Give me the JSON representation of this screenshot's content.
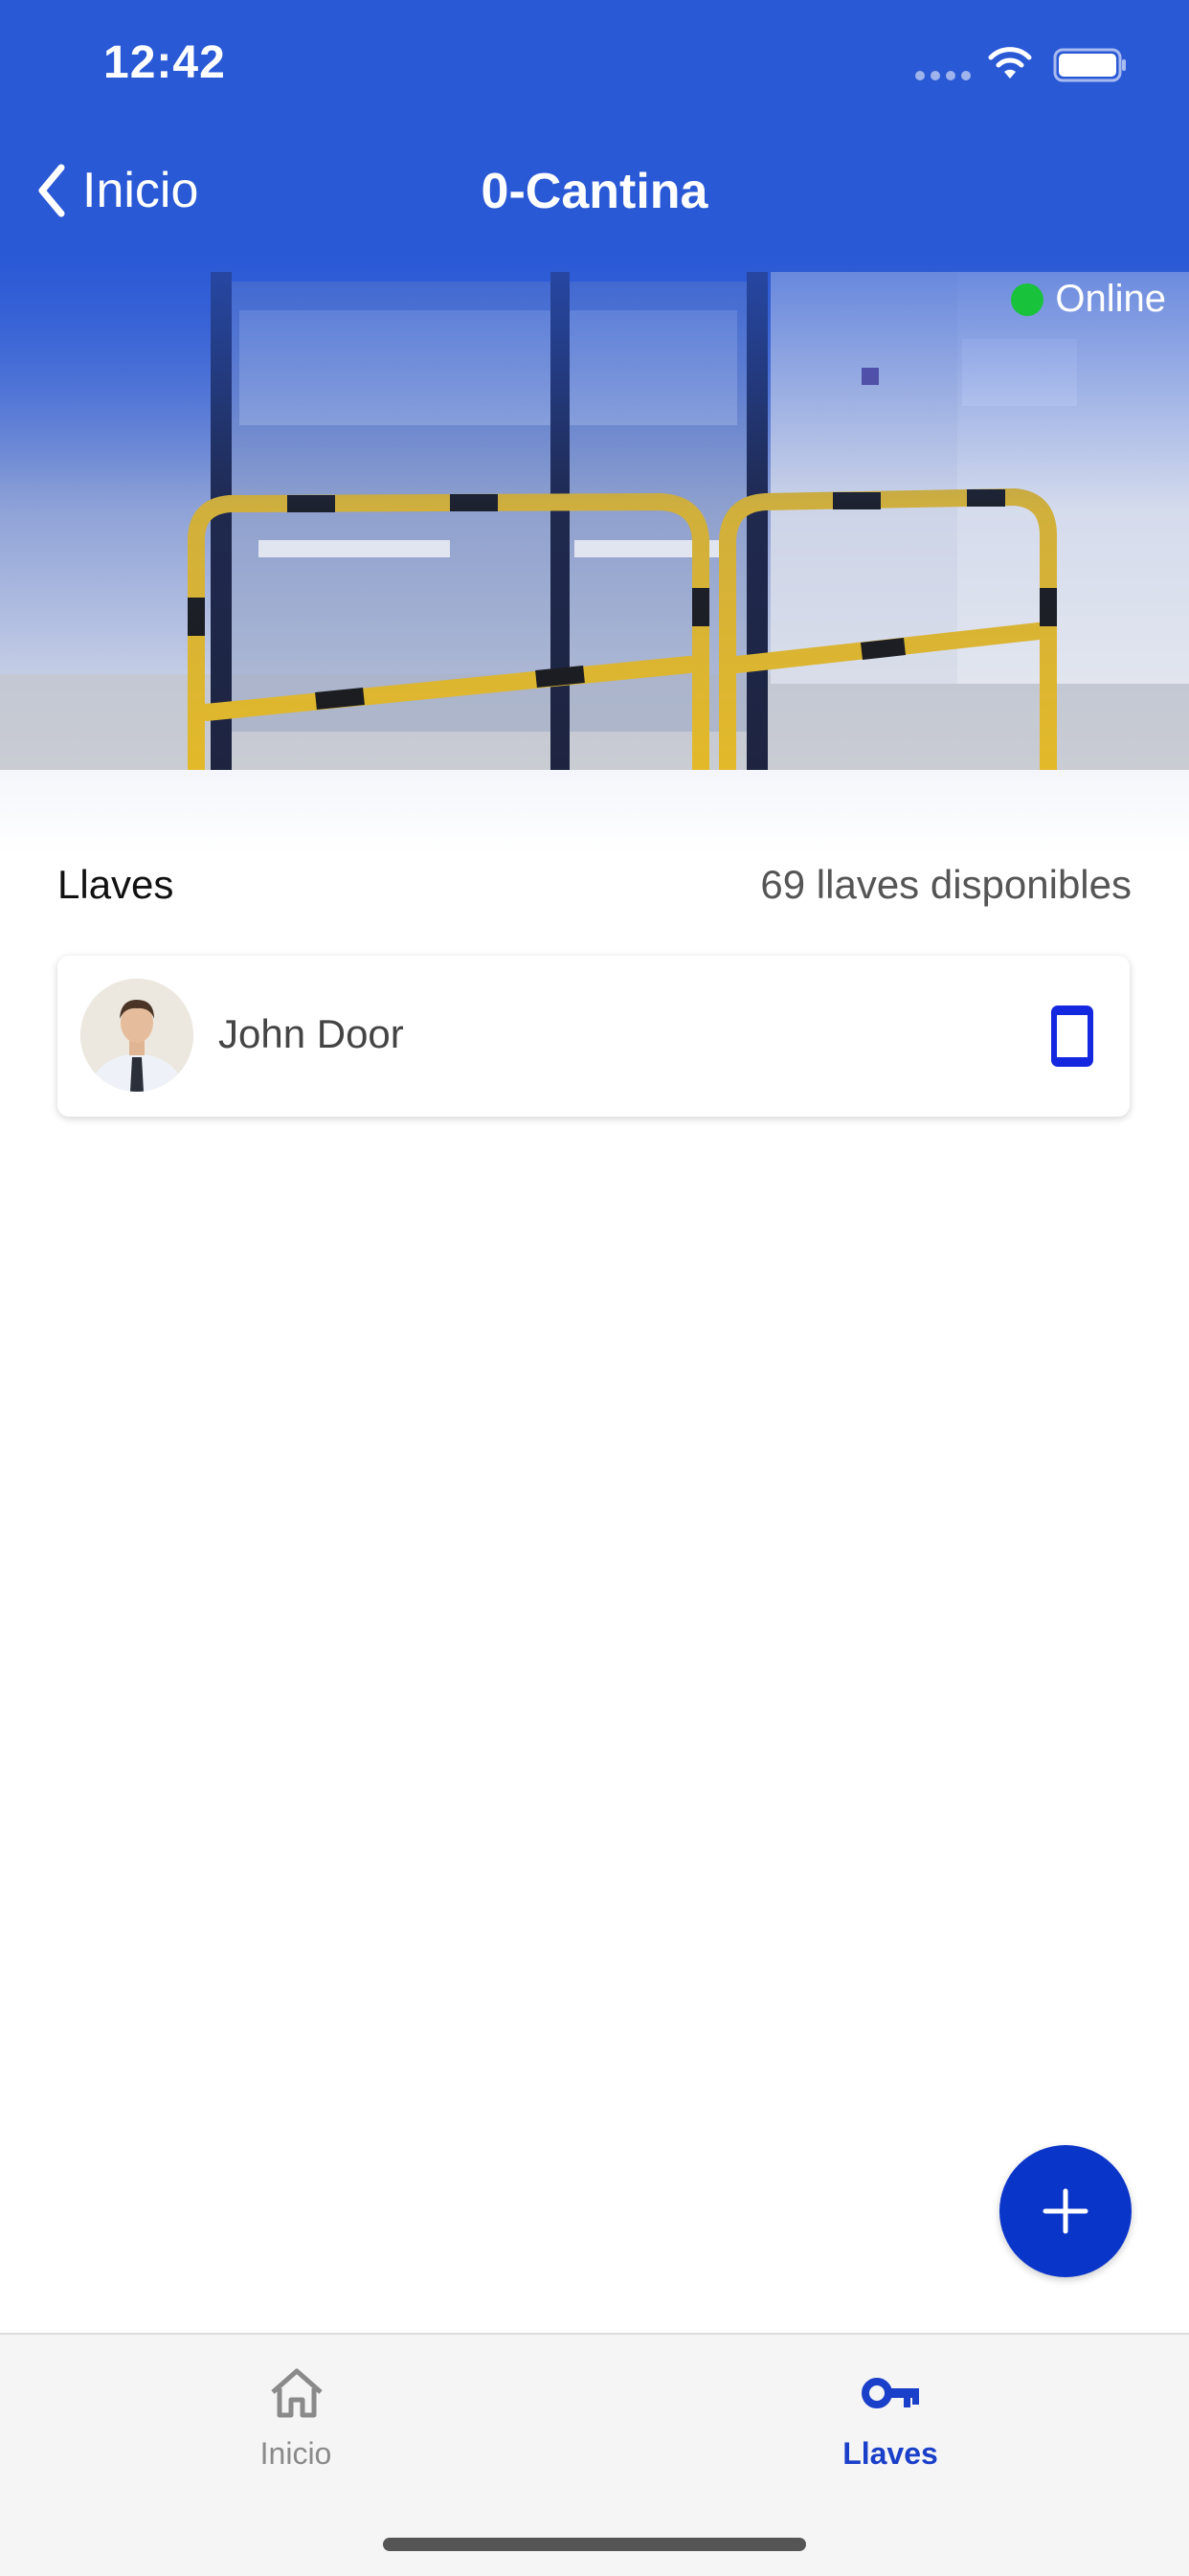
{
  "status_bar": {
    "time": "12:42"
  },
  "nav": {
    "back_label": "Inicio",
    "title": "0-Cantina"
  },
  "hero": {
    "status_label": "Online",
    "status_color": "#19c23b"
  },
  "keys": {
    "title": "Llaves",
    "count_label": "69 llaves disponibles",
    "items": [
      {
        "name": "John Door",
        "device_icon": "phone-icon"
      }
    ]
  },
  "fab": {
    "icon": "plus-icon"
  },
  "tab_bar": {
    "tabs": [
      {
        "label": "Inicio",
        "icon": "home-icon",
        "active": false
      },
      {
        "label": "Llaves",
        "icon": "key-icon",
        "active": true
      }
    ]
  },
  "colors": {
    "primary": "#2a59d6",
    "accent": "#0a35c9",
    "active_tab": "#1a3fc8"
  }
}
